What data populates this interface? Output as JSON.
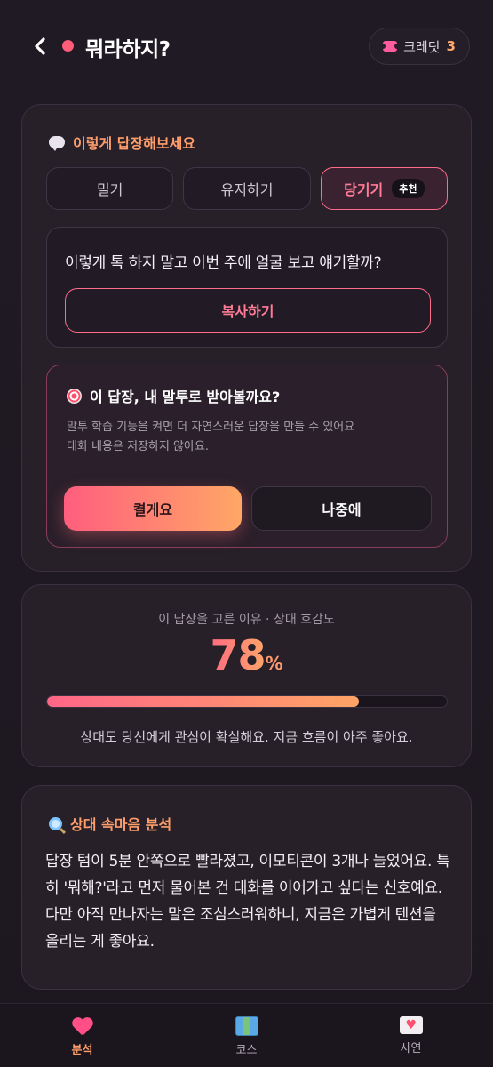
{
  "header": {
    "title": "뭐라하지?",
    "credit_label": "크레딧",
    "credit_count": "3"
  },
  "suggestion": {
    "section_title": "이렇게 답장해보세요",
    "tabs": [
      {
        "label": "밀기",
        "active": false,
        "badge": ""
      },
      {
        "label": "유지하기",
        "active": false,
        "badge": ""
      },
      {
        "label": "당기기",
        "active": true,
        "badge": "추천"
      }
    ],
    "reply_text": "이렇게 톡 하지 말고 이번 주에 얼굴 보고 얘기할까?",
    "copy_label": "복사하기"
  },
  "tone_prompt": {
    "title": "이 답장, 내 말투로 받아볼까요?",
    "desc_line1": "말투 학습 기능을 켜면 더 자연스러운 답장을 만들 수 있어요",
    "desc_line2": "대화 내용은 저장하지 않아요.",
    "enable_label": "켤게요",
    "later_label": "나중에"
  },
  "score": {
    "caption": "이 답장을 고른 이유 · 상대 호감도",
    "value": "78",
    "unit": "%",
    "fraction": 0.78,
    "description": "상대도 당신에게 관심이 확실해요. 지금 흐름이 아주 좋아요."
  },
  "analysis": {
    "title": "상대 속마음 분석",
    "body": "답장 텀이 5분 안쪽으로 빨라졌고, 이모티콘이 3개나 늘었어요. 특히 '뭐해?'라고 먼저 물어본 건 대화를 이어가고 싶다는 신호예요. 다만 아직 만나자는 말은 조심스러워하니, 지금은 가볍게 텐션을 올리는 게 좋아요."
  },
  "nav": [
    {
      "label": "분석",
      "icon": "heart-icon",
      "active": true
    },
    {
      "label": "코스",
      "icon": "map-icon",
      "active": false
    },
    {
      "label": "사연",
      "icon": "letter-icon",
      "active": false
    }
  ],
  "colors": {
    "accent": "#ff6b8b",
    "accent_orange": "#ffa466",
    "background": "#1c1720"
  }
}
